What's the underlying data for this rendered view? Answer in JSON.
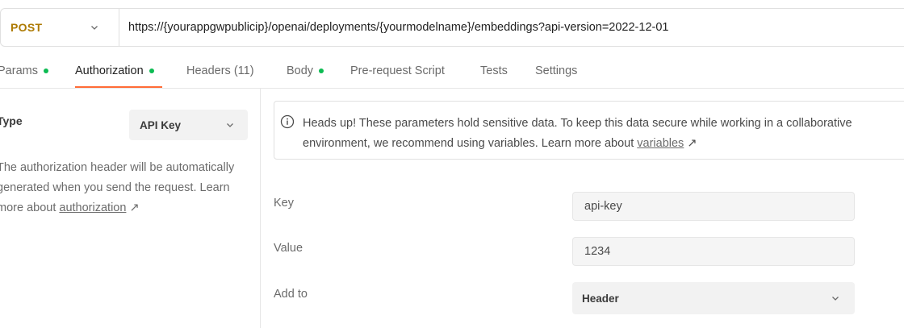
{
  "request": {
    "method": "POST",
    "url": "https://{yourappgwpublicip}/openai/deployments/{yourmodelname}/embeddings?api-version=2022-12-01"
  },
  "tabs": [
    {
      "label": "Params",
      "dot": true
    },
    {
      "label": "Authorization",
      "dot": true,
      "active": true
    },
    {
      "label": "Headers (11)",
      "dot": false
    },
    {
      "label": "Body",
      "dot": true
    },
    {
      "label": "Pre-request Script",
      "dot": false
    },
    {
      "label": "Tests",
      "dot": false
    },
    {
      "label": "Settings",
      "dot": false
    }
  ],
  "auth": {
    "type_label": "Type",
    "type_value": "API Key",
    "description_prefix": "The authorization header will be automatically generated when you send the request. Learn more about",
    "description_link": "authorization",
    "link_arrow": "↗"
  },
  "notice": {
    "line1": "Heads up! These parameters hold sensitive data. To keep this data secure while working in a collaborative",
    "line2_prefix": "environment, we recommend using variables. Learn more about",
    "line2_link": "variables",
    "link_arrow": "↗"
  },
  "fields": {
    "key_label": "Key",
    "key_value": "api-key",
    "value_label": "Value",
    "value_value": "1234",
    "add_to_label": "Add to",
    "add_to_value": "Header"
  },
  "colors": {
    "method": "#ad7a03",
    "dot": "#0cbb52",
    "active_underline": "#ff6c37"
  },
  "icons": {
    "method_dropdown": "chevron-down-icon",
    "auth_dropdown": "chevron-down-icon",
    "notice": "info-icon",
    "add_to_dropdown": "chevron-down-icon"
  }
}
